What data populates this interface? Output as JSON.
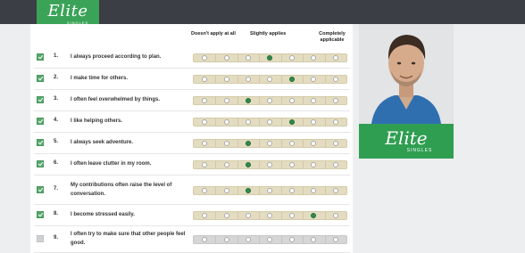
{
  "brand": {
    "name": "Elite",
    "sub": "SINGLES",
    "colors": {
      "green": "#3aa357",
      "topbar": "#3b3e45"
    }
  },
  "scale_labels": {
    "left": "Doesn't apply at all",
    "middle": "Slightly applies",
    "right": "Completely applicable"
  },
  "questions": [
    {
      "num": "1.",
      "text": "I always proceed according to plan.",
      "checked": true,
      "selected": 4
    },
    {
      "num": "2.",
      "text": "I make time for others.",
      "checked": true,
      "selected": 5
    },
    {
      "num": "3.",
      "text": "I often feel overwhelmed by things.",
      "checked": true,
      "selected": 3
    },
    {
      "num": "4.",
      "text": "I like helping others.",
      "checked": true,
      "selected": 5
    },
    {
      "num": "5.",
      "text": "I always seek adventure.",
      "checked": true,
      "selected": 3
    },
    {
      "num": "6.",
      "text": "I often leave clutter in my room.",
      "checked": true,
      "selected": 3
    },
    {
      "num": "7.",
      "text": "My contributions often raise the level of conversation.",
      "checked": true,
      "selected": 3
    },
    {
      "num": "8.",
      "text": "I become stressed easily.",
      "checked": true,
      "selected": 6
    },
    {
      "num": "9.",
      "text": "I often try to make sure that other people feel good.",
      "checked": false,
      "selected": null
    }
  ],
  "scale_points": 7,
  "icons": {
    "checkbox": "checkbox-icon",
    "profile_photo": "profile-photo"
  }
}
